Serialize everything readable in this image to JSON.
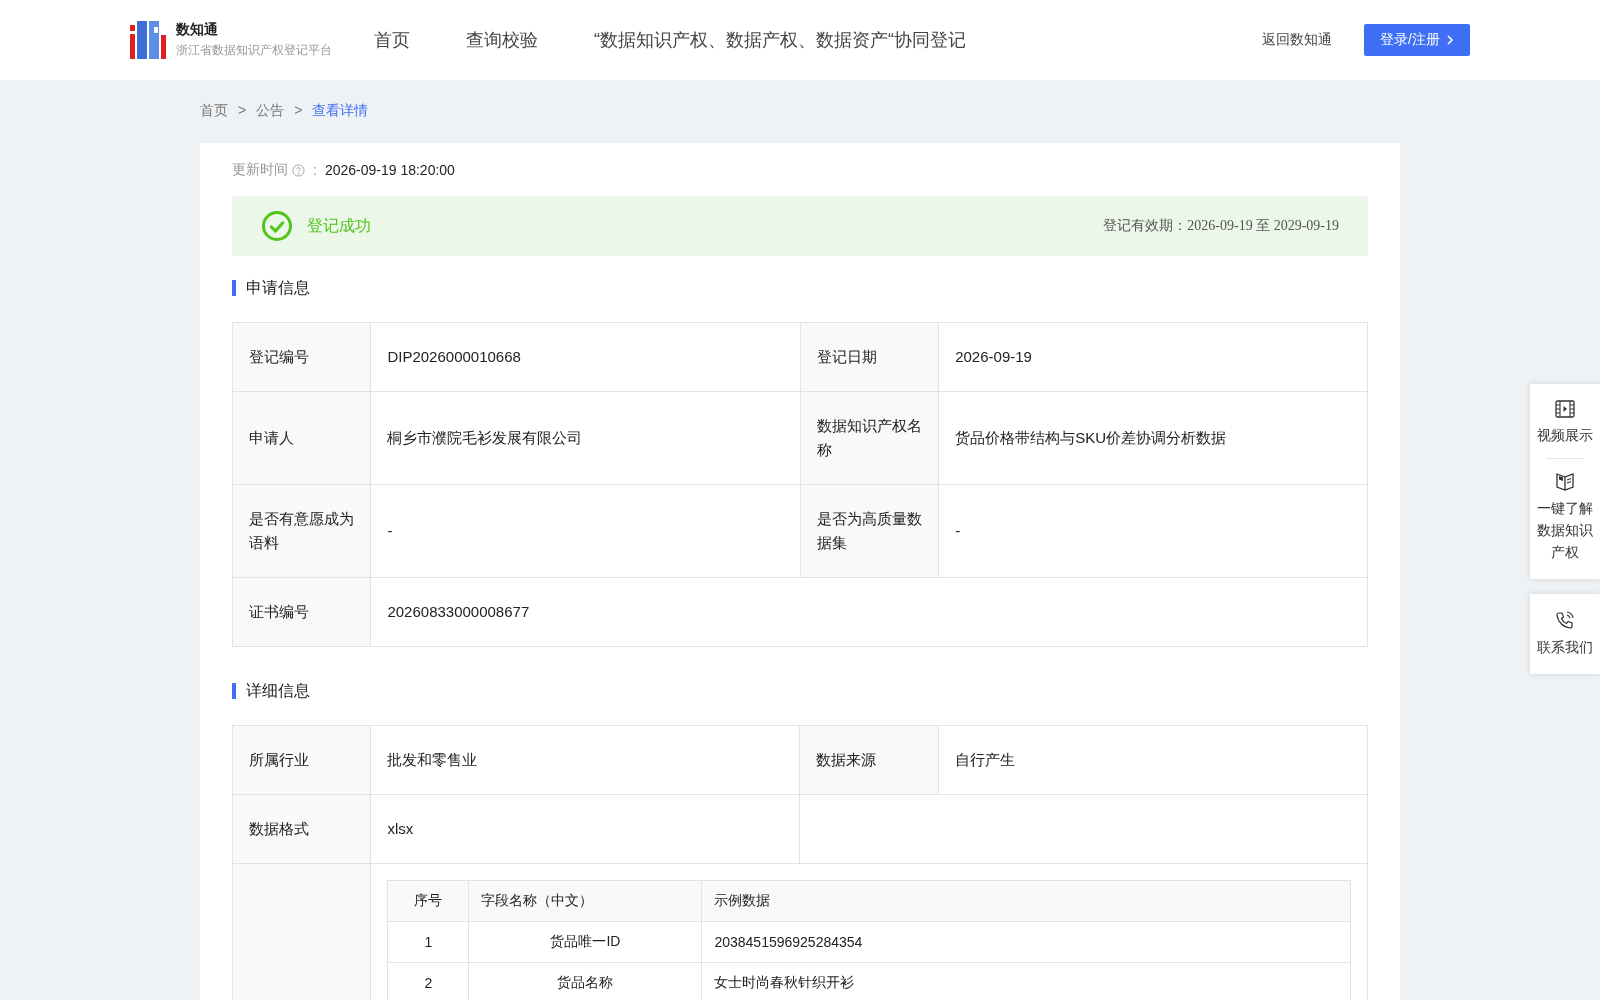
{
  "header": {
    "logo": {
      "title": "数知通",
      "subtitle": "浙江省数据知识产权登记平台"
    },
    "nav": [
      {
        "label": "首页"
      },
      {
        "label": "查询校验"
      },
      {
        "label": "“数据知识产权、数据产权、数据资产“协同登记"
      }
    ],
    "back_link": "返回数知通",
    "login_button": "登录/注册"
  },
  "breadcrumb": [
    {
      "label": "首页",
      "current": false
    },
    {
      "label": "公告",
      "current": false
    },
    {
      "label": "查看详情",
      "current": true
    }
  ],
  "breadcrumb_separator": ">",
  "update_time": {
    "label": "更新时间",
    "separator": ":",
    "value": "2026-09-19 18:20:00"
  },
  "status": {
    "label": "登记成功",
    "validity": "登记有效期：2026-09-19 至 2029-09-19"
  },
  "application_info": {
    "title": "申请信息",
    "rows": [
      [
        {
          "label": "登记编号",
          "value": "DIP2026000010668"
        },
        {
          "label": "登记日期",
          "value": "2026-09-19"
        }
      ],
      [
        {
          "label": "申请人",
          "value": "桐乡市濮院毛衫发展有限公司"
        },
        {
          "label": "数据知识产权名称",
          "value": "货品价格带结构与SKU价差协调分析数据"
        }
      ],
      [
        {
          "label": "是否有意愿成为语料",
          "value": "-"
        },
        {
          "label": "是否为高质量数据集",
          "value": "-"
        }
      ],
      [
        {
          "label": "证书编号",
          "value": "20260833000008677"
        }
      ]
    ]
  },
  "detail_info": {
    "title": "详细信息",
    "rows": [
      [
        {
          "label": "所属行业",
          "value": "批发和零售业"
        },
        {
          "label": "数据来源",
          "value": "自行产生"
        }
      ]
    ],
    "format": {
      "label": "数据格式",
      "value": "xlsx"
    },
    "fields": {
      "columns": [
        "序号",
        "字段名称（中文）",
        "示例数据"
      ],
      "rows": [
        [
          "1",
          "货品唯一ID",
          "2038451596925284354"
        ],
        [
          "2",
          "货品名称",
          "女士时尚春秋针织开衫"
        ]
      ]
    }
  },
  "side_panels": [
    {
      "tools": [
        {
          "kind": "video",
          "label": "视频展示"
        },
        {
          "kind": "book",
          "label": "一键了解数据知识产权"
        }
      ]
    },
    {
      "tools": [
        {
          "kind": "phone",
          "label": "联系我们"
        }
      ]
    }
  ]
}
